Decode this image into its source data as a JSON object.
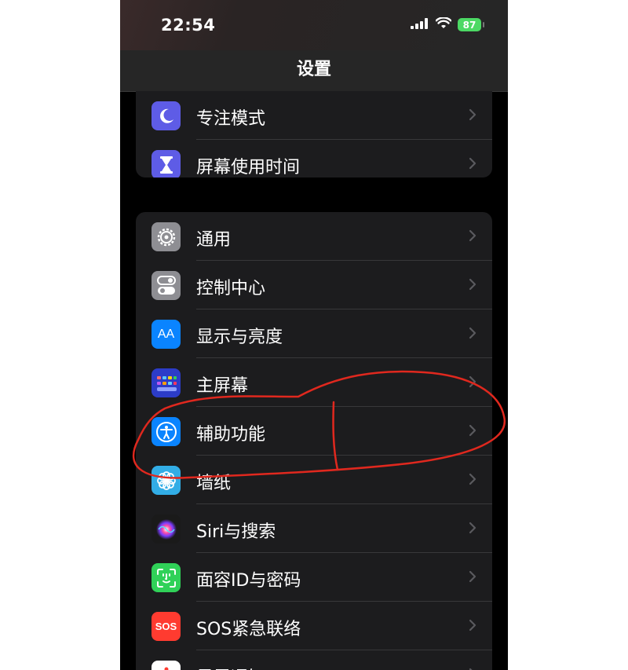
{
  "status_bar": {
    "time": "22:54",
    "battery": "87"
  },
  "nav": {
    "title": "设置"
  },
  "group1": [
    {
      "label": "专注模式",
      "icon": "moon-icon",
      "color": "#5e5ce6"
    },
    {
      "label": "屏幕使用时间",
      "icon": "hourglass-icon",
      "color": "#5e5ce6"
    }
  ],
  "group2": [
    {
      "label": "通用",
      "icon": "gear-icon",
      "color": "#8e8e93"
    },
    {
      "label": "控制中心",
      "icon": "toggles-icon",
      "color": "#8e8e93"
    },
    {
      "label": "显示与亮度",
      "icon": "aa-icon",
      "icon_text": "AA",
      "color": "#0a84ff"
    },
    {
      "label": "主屏幕",
      "icon": "home-grid-icon",
      "color": "#2c3cc8"
    },
    {
      "label": "辅助功能",
      "icon": "accessibility-icon",
      "color": "#0a84ff"
    },
    {
      "label": "墙纸",
      "icon": "flower-icon",
      "color": "#32ade6"
    },
    {
      "label": "Siri与搜索",
      "icon": "siri-icon",
      "color": "#1a1a1a"
    },
    {
      "label": "面容ID与密码",
      "icon": "face-id-icon",
      "color": "#30d158"
    },
    {
      "label": "SOS紧急联络",
      "icon": "sos-icon",
      "icon_text": "SOS",
      "color": "#ff3b30"
    },
    {
      "label": "暴露通知",
      "icon": "exposure-icon",
      "color": "#ffffff"
    }
  ],
  "annotation": {
    "color": "#e0281e"
  }
}
